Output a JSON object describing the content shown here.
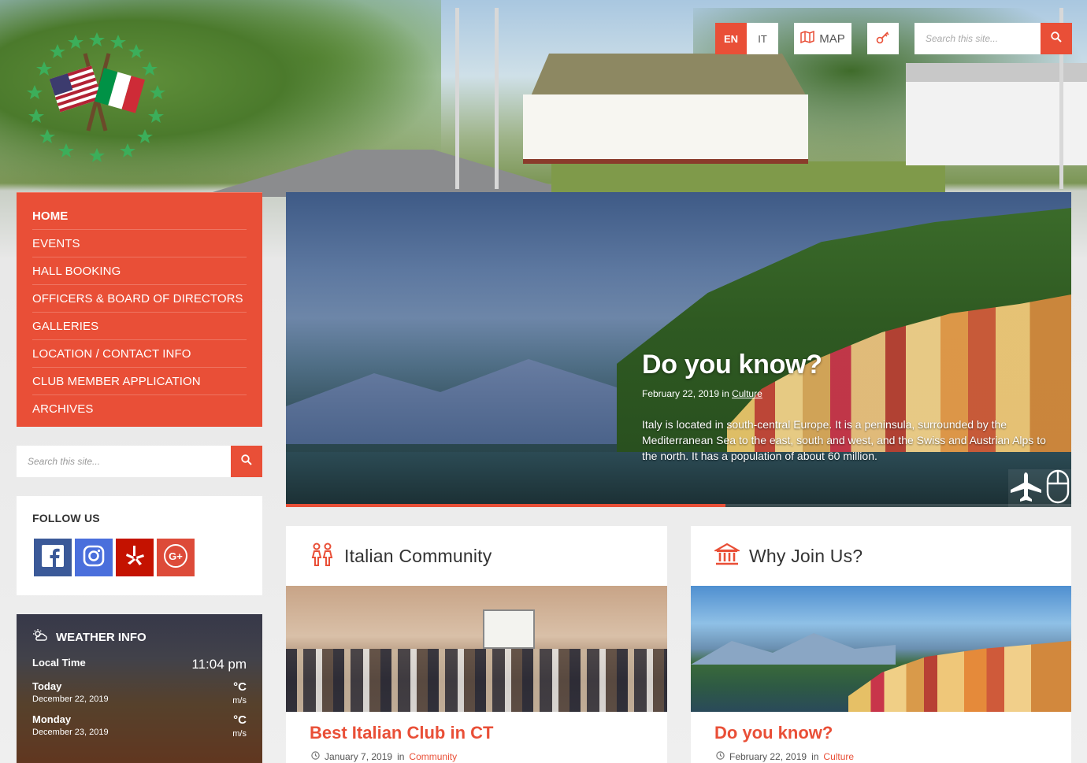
{
  "header": {
    "languages": [
      {
        "code": "EN",
        "active": true
      },
      {
        "code": "IT",
        "active": false
      }
    ],
    "map_label": "MAP",
    "search_placeholder": "Search this site..."
  },
  "nav": {
    "items": [
      {
        "label": "HOME",
        "active": true
      },
      {
        "label": "EVENTS"
      },
      {
        "label": "HALL BOOKING"
      },
      {
        "label": "OFFICERS & BOARD OF DIRECTORS"
      },
      {
        "label": "GALLERIES"
      },
      {
        "label": "LOCATION / CONTACT INFO"
      },
      {
        "label": "CLUB MEMBER APPLICATION"
      },
      {
        "label": "ARCHIVES"
      }
    ]
  },
  "sidebar_search": {
    "placeholder": "Search this site..."
  },
  "follow": {
    "title": "FOLLOW US",
    "networks": [
      {
        "icon": "facebook-icon",
        "color": "#3b5998"
      },
      {
        "icon": "instagram-icon",
        "color": "#4a6fdc"
      },
      {
        "icon": "yelp-icon",
        "color": "#c41200"
      },
      {
        "icon": "google-plus-icon",
        "color": "#dd4b39"
      }
    ]
  },
  "weather": {
    "title": "WEATHER INFO",
    "local_time_label": "Local Time",
    "local_time": "11:04 pm",
    "days": [
      {
        "label": "Today",
        "date": "December 22, 2019",
        "temp": "°C",
        "wind": "m/s"
      },
      {
        "label": "Monday",
        "date": "December 23, 2019",
        "temp": "°C",
        "wind": "m/s"
      }
    ]
  },
  "hero": {
    "title": "Do you know?",
    "date": "February 22, 2019",
    "in": "in",
    "category": "Culture",
    "excerpt": "Italy is located in south-central Europe. It is a peninsula, surrounded by the Mediterranean Sea to the east, south and west, and the Swiss and Austrian Alps to the north. It has a population of about 60 million.",
    "progress": 0.56
  },
  "cards": [
    {
      "heading": "Italian Community",
      "icon": "people-icon",
      "post_title": "Best Italian Club in CT",
      "date": "January 7, 2019",
      "in": "in",
      "category": "Community"
    },
    {
      "heading": "Why Join Us?",
      "icon": "bank-icon",
      "post_title": "Do you know?",
      "date": "February 22, 2019",
      "in": "in",
      "category": "Culture"
    }
  ],
  "colors": {
    "accent": "#e94f37"
  }
}
